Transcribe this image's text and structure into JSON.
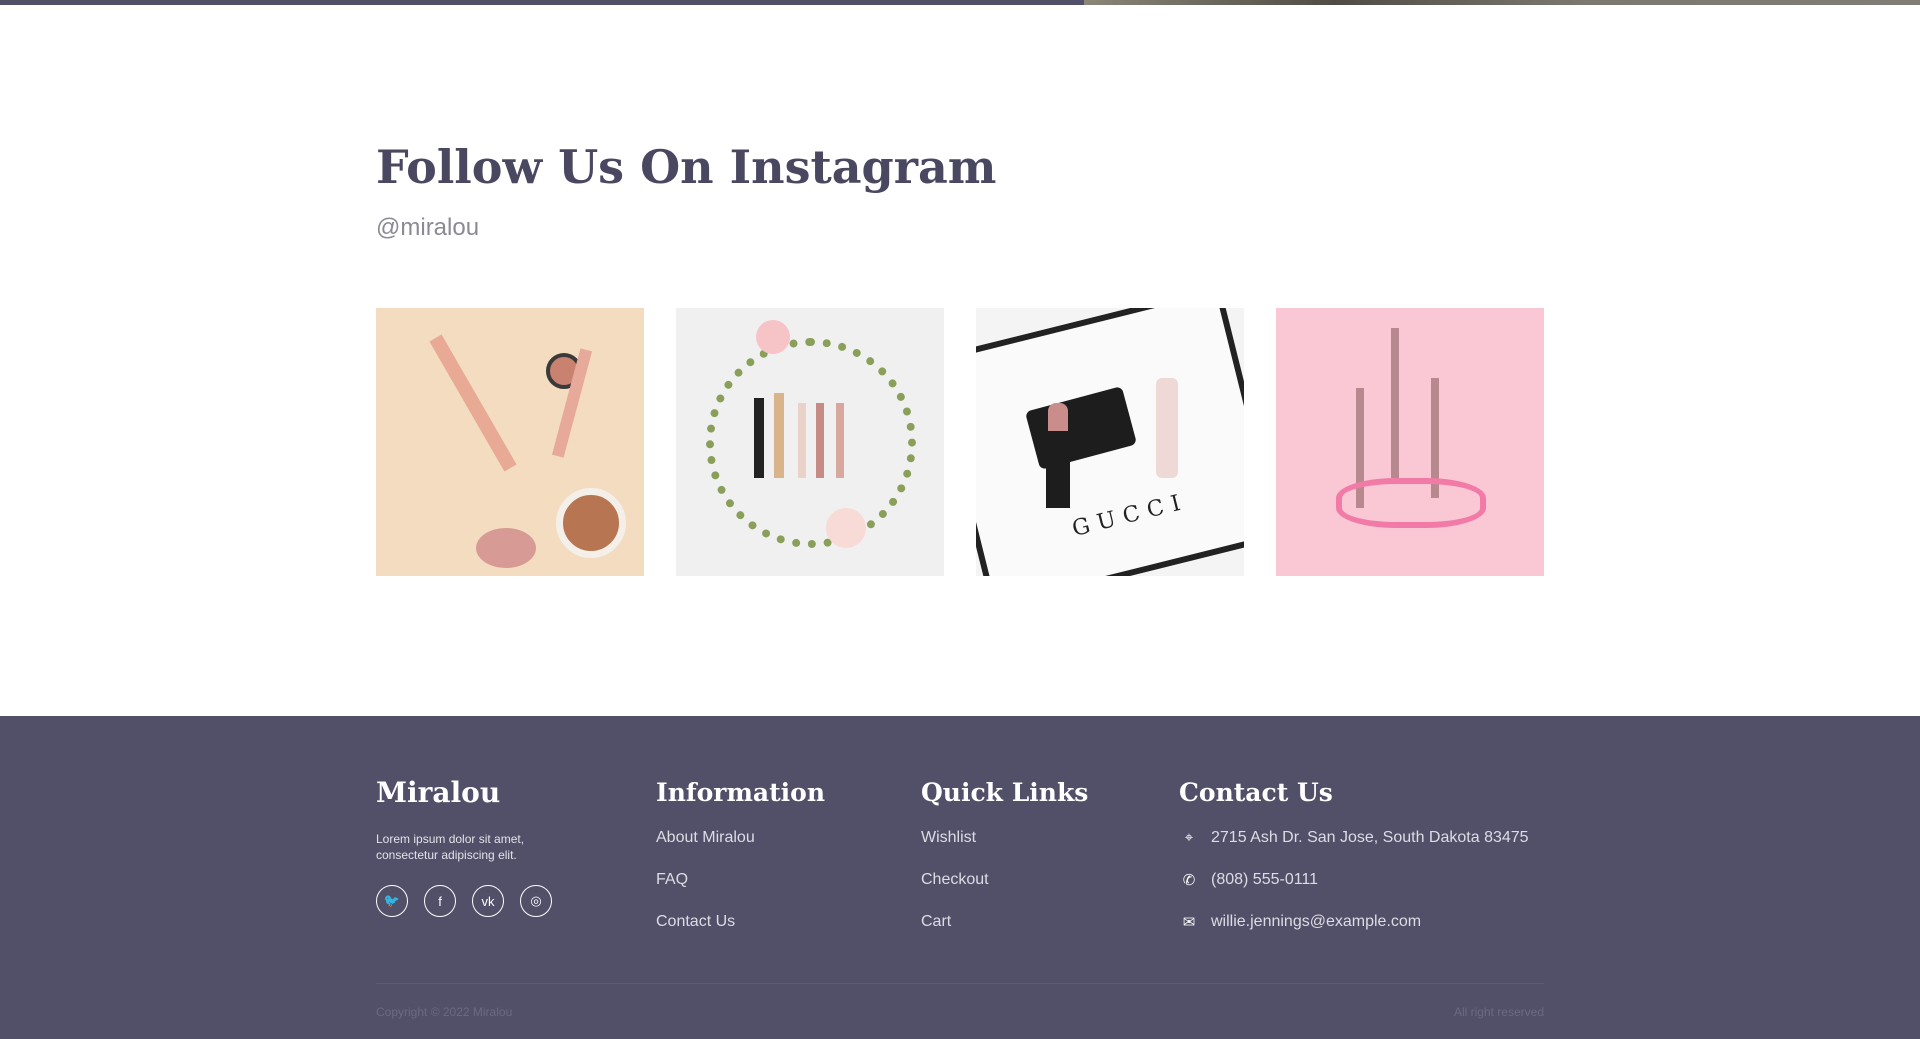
{
  "instagram": {
    "title": "Follow Us On Instagram",
    "handle": "@miralou",
    "images": [
      {
        "name": "makeup-brushes-flatlay"
      },
      {
        "name": "floral-makeup-wreath"
      },
      {
        "name": "gucci-chanel-cosmetics"
      },
      {
        "name": "pink-eyeliners-ribbon"
      }
    ]
  },
  "footer": {
    "brand": "Miralou",
    "description": "Lorem ipsum dolor sit amet, consectetur adipiscing elit.",
    "social": [
      {
        "icon": "twitter-icon",
        "glyph": "🐦"
      },
      {
        "icon": "facebook-icon",
        "glyph": "f"
      },
      {
        "icon": "vk-icon",
        "glyph": "vk"
      },
      {
        "icon": "instagram-icon",
        "glyph": "◎"
      }
    ],
    "information": {
      "title": "Information",
      "links": [
        "About Miralou",
        "FAQ",
        "Contact Us"
      ]
    },
    "quick_links": {
      "title": "Quick Links",
      "links": [
        "Wishlist",
        "Checkout",
        "Cart"
      ]
    },
    "contact": {
      "title": "Contact Us",
      "address": "2715 Ash Dr. San Jose, South Dakota 83475",
      "phone": "(808) 555-0111",
      "email": "willie.jennings@example.com"
    },
    "copyright": "Copyright © 2022 Miralou",
    "rights": "All right reserved"
  },
  "colors": {
    "primary": "#524f68",
    "heading": "#4a4761"
  }
}
